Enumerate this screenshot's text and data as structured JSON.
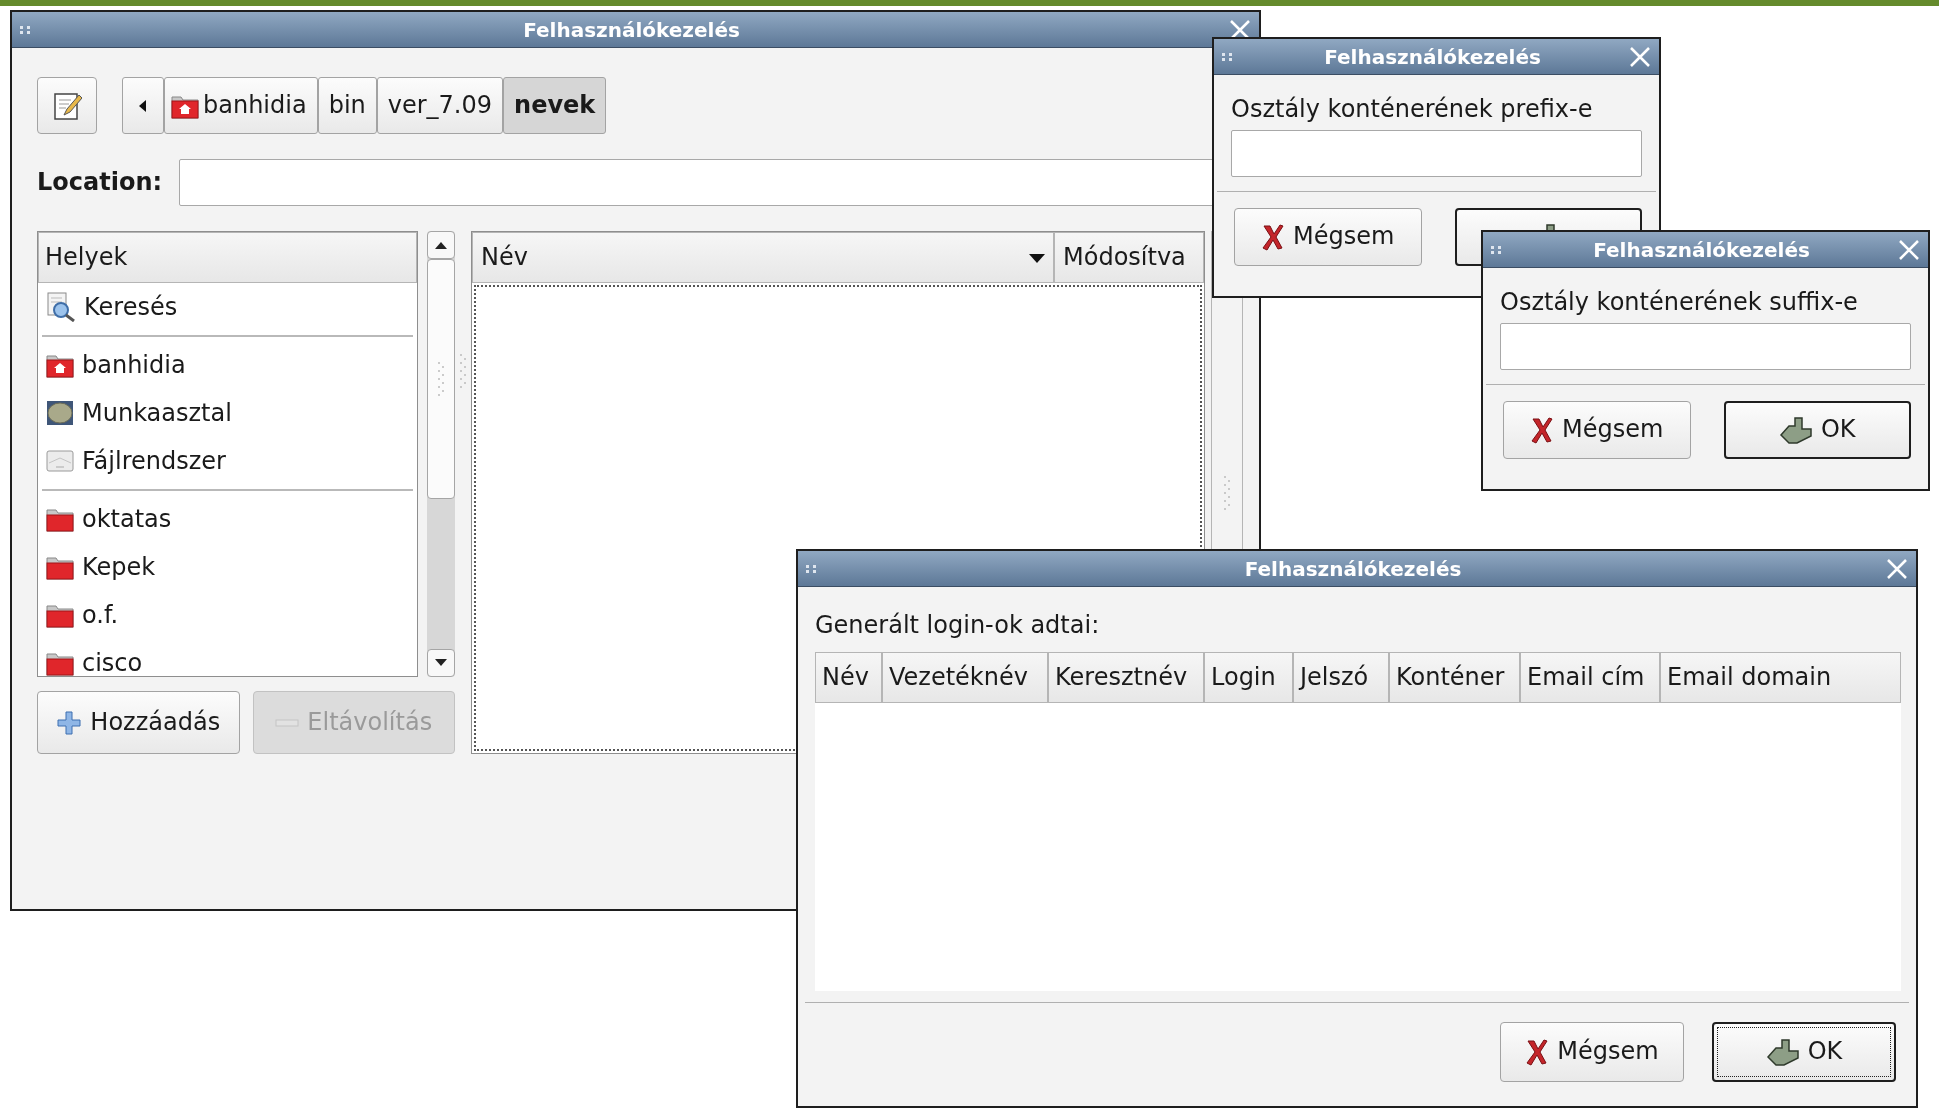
{
  "file_window": {
    "title": "Felhasználókezelés",
    "path": [
      {
        "label": "banhidia",
        "kind": "home",
        "selected": false
      },
      {
        "label": "bin",
        "kind": "plain",
        "selected": false
      },
      {
        "label": "ver_7.09",
        "kind": "plain",
        "selected": false
      },
      {
        "label": "nevek",
        "kind": "plain",
        "selected": true
      }
    ],
    "location_label": "Location:",
    "places_header": "Helyek",
    "place_groups": [
      {
        "items": [
          {
            "label": "Keresés",
            "kind": "search"
          }
        ]
      },
      {
        "items": [
          {
            "label": "banhidia",
            "kind": "home"
          },
          {
            "label": "Munkaasztal",
            "kind": "desktop"
          },
          {
            "label": "Fájlrendszer",
            "kind": "drive"
          }
        ]
      },
      {
        "items": [
          {
            "label": "oktatas",
            "kind": "folder"
          },
          {
            "label": "Kepek",
            "kind": "folder"
          },
          {
            "label": "o.f.",
            "kind": "folder"
          },
          {
            "label": "cisco",
            "kind": "folder"
          }
        ]
      }
    ],
    "columns": [
      {
        "label": "Név",
        "sorted": true
      },
      {
        "label": "Módosítva",
        "sorted": false
      }
    ],
    "buttons": [
      {
        "label": "Hozzáadás",
        "kind": "add",
        "disabled": false
      },
      {
        "label": "Eltávolítás",
        "kind": "remove",
        "disabled": true
      }
    ]
  },
  "prefix_dialog": {
    "title": "Felhasználókezelés",
    "prompt": "Osztály konténerének prefix-e",
    "buttons": [
      {
        "label": "Mégsem",
        "kind": "cancel",
        "default": false
      },
      {
        "kind": "ok",
        "default": true
      }
    ]
  },
  "suffix_dialog": {
    "title": "Felhasználókezelés",
    "prompt": "Osztály konténerének suffix-e",
    "buttons": [
      {
        "label": "Mégsem",
        "kind": "cancel",
        "default": false
      },
      {
        "label": "OK",
        "kind": "ok",
        "default": true
      }
    ]
  },
  "login_dialog": {
    "title": "Felhasználókezelés",
    "caption": "Generált login-ok adtai:",
    "columns": [
      "Név",
      "Vezetéknév",
      "Keresztnév",
      "Login",
      "Jelszó",
      "Konténer",
      "Email cím",
      "Email domain"
    ],
    "buttons": [
      {
        "label": "Mégsem",
        "kind": "cancel",
        "default": false,
        "focused": false
      },
      {
        "label": "OK",
        "kind": "ok",
        "default": true,
        "focused": true
      }
    ]
  }
}
